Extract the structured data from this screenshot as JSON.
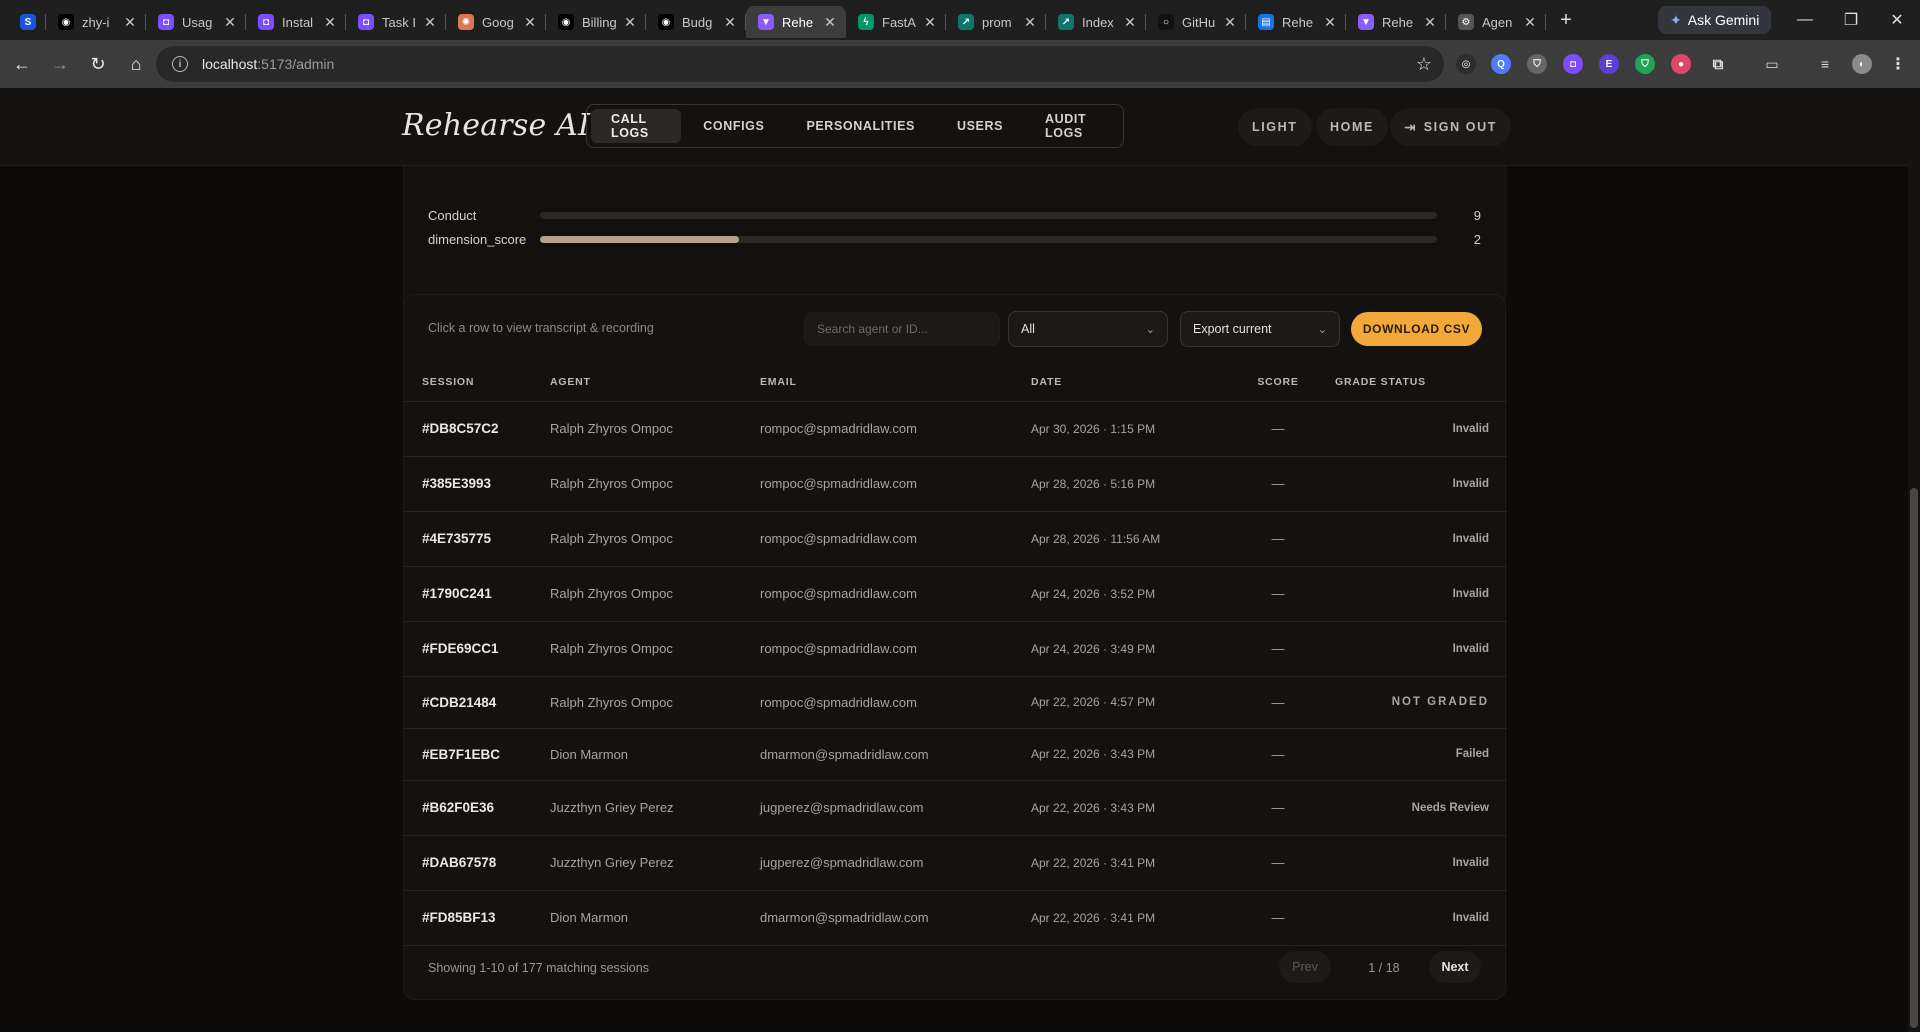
{
  "browser": {
    "tabs": [
      {
        "title": "",
        "fav_color": "#1a56db",
        "fav_glyph": "S"
      },
      {
        "title": "zhy-i",
        "fav_color": "#000000",
        "fav_glyph": "◉"
      },
      {
        "title": "Usag",
        "fav_color": "#7c4dff",
        "fav_glyph": "◘"
      },
      {
        "title": "Instal",
        "fav_color": "#7c4dff",
        "fav_glyph": "◘"
      },
      {
        "title": "Task I",
        "fav_color": "#7c4dff",
        "fav_glyph": "◘"
      },
      {
        "title": "Goog",
        "fav_color": "#d97757",
        "fav_glyph": "✺"
      },
      {
        "title": "Billing",
        "fav_color": "#000000",
        "fav_glyph": "◉"
      },
      {
        "title": "Budg",
        "fav_color": "#000000",
        "fav_glyph": "◉"
      },
      {
        "title": "Rehe",
        "fav_color": "#8b5cf6",
        "fav_glyph": "▼",
        "active": true
      },
      {
        "title": "FastA",
        "fav_color": "#059669",
        "fav_glyph": "ϟ"
      },
      {
        "title": "prom",
        "fav_color": "#0f766e",
        "fav_glyph": "↗"
      },
      {
        "title": "Index",
        "fav_color": "#0f766e",
        "fav_glyph": "↗"
      },
      {
        "title": "GitHu",
        "fav_color": "#111111",
        "fav_glyph": "○"
      },
      {
        "title": "Rehe",
        "fav_color": "#1a73e8",
        "fav_glyph": "▤"
      },
      {
        "title": "Rehe",
        "fav_color": "#8b5cf6",
        "fav_glyph": "▼"
      },
      {
        "title": "Agen",
        "fav_color": "#555555",
        "fav_glyph": "⚙"
      }
    ],
    "gemini_label": "Ask Gemini",
    "url_host": "localhost",
    "url_path": ":5173/admin"
  },
  "header": {
    "brand": "Rehearse AI",
    "nav": [
      {
        "label": "CALL LOGS",
        "active": true
      },
      {
        "label": "CONFIGS"
      },
      {
        "label": "PERSONALITIES"
      },
      {
        "label": "USERS"
      },
      {
        "label": "AUDIT LOGS"
      }
    ],
    "light_label": "LIGHT",
    "home_label": "HOME",
    "signout_label": "SIGN OUT"
  },
  "dimensions": [
    {
      "label": "Conduct",
      "value": "9",
      "fraction": 0.0
    },
    {
      "label": "dimension_score",
      "value": "2",
      "fraction": 0.222
    }
  ],
  "logs": {
    "hint": "Click a row to view transcript & recording",
    "search_placeholder": "Search agent or ID...",
    "filter_value": "All",
    "export_value": "Export current",
    "download_label": "DOWNLOAD CSV",
    "columns": [
      "SESSION",
      "AGENT",
      "EMAIL",
      "DATE",
      "SCORE",
      "GRADE STATUS"
    ],
    "rows": [
      {
        "session": "#DB8C57C2",
        "agent": "Ralph Zhyros Ompoc",
        "email": "rompoc@spmadridlaw.com",
        "date": "Apr 30, 2026 · 1:15 PM",
        "score": "—",
        "status": "Invalid",
        "kind": "invalid"
      },
      {
        "session": "#385E3993",
        "agent": "Ralph Zhyros Ompoc",
        "email": "rompoc@spmadridlaw.com",
        "date": "Apr 28, 2026 · 5:16 PM",
        "score": "—",
        "status": "Invalid",
        "kind": "invalid"
      },
      {
        "session": "#4E735775",
        "agent": "Ralph Zhyros Ompoc",
        "email": "rompoc@spmadridlaw.com",
        "date": "Apr 28, 2026 · 11:56 AM",
        "score": "—",
        "status": "Invalid",
        "kind": "invalid"
      },
      {
        "session": "#1790C241",
        "agent": "Ralph Zhyros Ompoc",
        "email": "rompoc@spmadridlaw.com",
        "date": "Apr 24, 2026 · 3:52 PM",
        "score": "—",
        "status": "Invalid",
        "kind": "invalid"
      },
      {
        "session": "#FDE69CC1",
        "agent": "Ralph Zhyros Ompoc",
        "email": "rompoc@spmadridlaw.com",
        "date": "Apr 24, 2026 · 3:49 PM",
        "score": "—",
        "status": "Invalid",
        "kind": "invalid"
      },
      {
        "session": "#CDB21484",
        "agent": "Ralph Zhyros Ompoc",
        "email": "rompoc@spmadridlaw.com",
        "date": "Apr 22, 2026 · 4:57 PM",
        "score": "—",
        "status": "NOT GRADED",
        "kind": "notgraded"
      },
      {
        "session": "#EB7F1EBC",
        "agent": "Dion Marmon",
        "email": "dmarmon@spmadridlaw.com",
        "date": "Apr 22, 2026 · 3:43 PM",
        "score": "—",
        "status": "Failed",
        "kind": "failed"
      },
      {
        "session": "#B62F0E36",
        "agent": "Juzzthyn Griey Perez",
        "email": "jugperez@spmadridlaw.com",
        "date": "Apr 22, 2026 · 3:43 PM",
        "score": "—",
        "status": "Needs Review",
        "kind": "review"
      },
      {
        "session": "#DAB67578",
        "agent": "Juzzthyn Griey Perez",
        "email": "jugperez@spmadridlaw.com",
        "date": "Apr 22, 2026 · 3:41 PM",
        "score": "—",
        "status": "Invalid",
        "kind": "invalid"
      },
      {
        "session": "#FD85BF13",
        "agent": "Dion Marmon",
        "email": "dmarmon@spmadridlaw.com",
        "date": "Apr 22, 2026 · 3:41 PM",
        "score": "—",
        "status": "Invalid",
        "kind": "invalid"
      }
    ],
    "showing": "Showing 1-10 of 177 matching sessions",
    "prev_label": "Prev",
    "page_info": "1 / 18",
    "next_label": "Next"
  }
}
